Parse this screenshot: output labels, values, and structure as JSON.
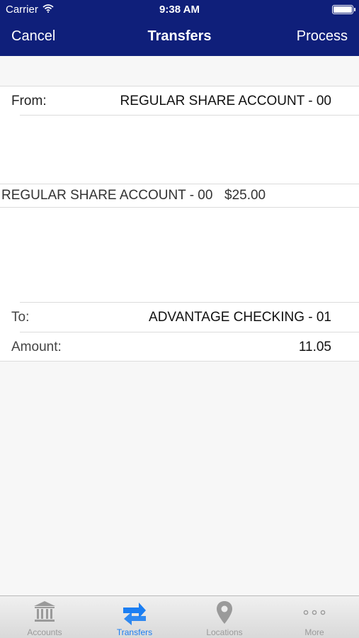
{
  "status_bar": {
    "carrier": "Carrier",
    "time": "9:38 AM"
  },
  "nav": {
    "cancel": "Cancel",
    "title": "Transfers",
    "process": "Process"
  },
  "from": {
    "label": "From:",
    "value": "REGULAR SHARE ACCOUNT - 00"
  },
  "picker": {
    "account": "REGULAR SHARE ACCOUNT - 00",
    "balance": "$25.00"
  },
  "to": {
    "label": "To:",
    "value": "ADVANTAGE CHECKING - 01"
  },
  "amount": {
    "label": "Amount:",
    "value": "11.05"
  },
  "tabs": [
    {
      "label": "Accounts",
      "icon": "bank-icon"
    },
    {
      "label": "Transfers",
      "icon": "transfer-arrows-icon"
    },
    {
      "label": "Locations",
      "icon": "map-pin-icon"
    },
    {
      "label": "More",
      "icon": "more-dots-icon"
    }
  ],
  "colors": {
    "header": "#0f1f7a",
    "active_tab": "#1b7ef2",
    "inactive_tab": "#9a9a9a"
  }
}
